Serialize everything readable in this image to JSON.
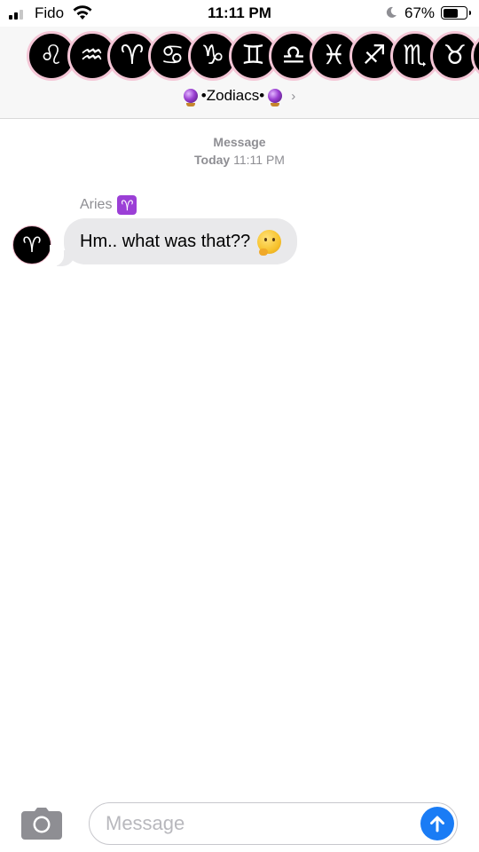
{
  "status_bar": {
    "carrier": "Fido",
    "time": "11:11 PM",
    "battery_percent": "67%",
    "battery_level": 0.67,
    "signal_bars_filled": 2,
    "signal_bars_total": 3
  },
  "header": {
    "group_avatars": [
      {
        "symbol": "♌",
        "sign": "Leo"
      },
      {
        "symbol": "♒",
        "sign": "Aquarius"
      },
      {
        "symbol": "♈",
        "sign": "Aries"
      },
      {
        "symbol": "♋",
        "sign": "Cancer"
      },
      {
        "symbol": "♑",
        "sign": "Capricorn"
      },
      {
        "symbol": "♊",
        "sign": "Gemini"
      },
      {
        "symbol": "♎",
        "sign": "Libra"
      },
      {
        "symbol": "♓",
        "sign": "Pisces"
      },
      {
        "symbol": "♐",
        "sign": "Sagittarius"
      },
      {
        "symbol": "♏",
        "sign": "Scorpio"
      },
      {
        "symbol": "♉",
        "sign": "Taurus"
      },
      {
        "symbol": "♍",
        "sign": "Virgo"
      }
    ],
    "group_name": "•Zodiacs•"
  },
  "timestamp": {
    "title": "Message",
    "day": "Today",
    "time": "11:11 PM"
  },
  "messages": [
    {
      "sender": "Aries",
      "sender_badge": "♈",
      "avatar_symbol": "♈",
      "text": "Hm.. what was that??"
    }
  ],
  "composer": {
    "placeholder": "Message"
  },
  "icons": {
    "wifi": "wifi-icon",
    "moon": "do-not-disturb-moon-icon",
    "camera": "camera-icon",
    "send": "send-arrow-up-icon",
    "crystal_ball": "crystal-ball-emoji",
    "thinking": "thinking-face-emoji"
  },
  "colors": {
    "send_button": "#1a7cf5",
    "incoming_bubble": "#e9e9eb",
    "badge_purple": "#9b3fd6",
    "avatar_border": "#f4c6d6"
  }
}
